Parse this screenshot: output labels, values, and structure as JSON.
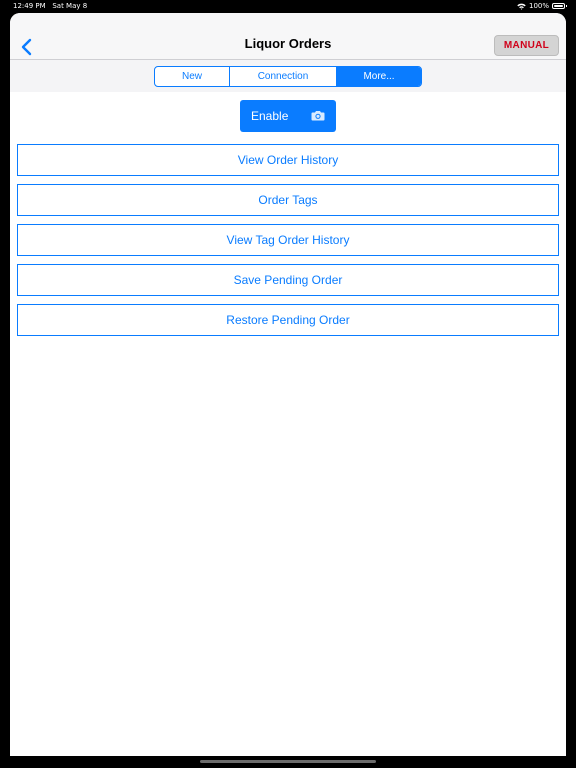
{
  "status_bar": {
    "time": "12:49 PM",
    "date": "Sat May 8",
    "battery_percent": "100%",
    "wifi_icon": "wifi-icon",
    "battery_icon": "battery-icon"
  },
  "nav": {
    "back_icon": "chevron-left-icon",
    "title": "Liquor Orders",
    "manual_label": "MANUAL"
  },
  "segments": [
    {
      "label": "New",
      "selected": false
    },
    {
      "label": "Connection",
      "selected": false
    },
    {
      "label": "More...",
      "selected": true
    }
  ],
  "enable": {
    "label": "Enable",
    "icon": "camera-icon"
  },
  "menu": [
    {
      "label": "View Order History"
    },
    {
      "label": "Order Tags"
    },
    {
      "label": "View Tag Order History"
    },
    {
      "label": "Save Pending Order"
    },
    {
      "label": "Restore Pending Order"
    }
  ],
  "colors": {
    "accent": "#0a7cff",
    "manual_text": "#d0021b",
    "nav_background": "#f7f7f8"
  }
}
